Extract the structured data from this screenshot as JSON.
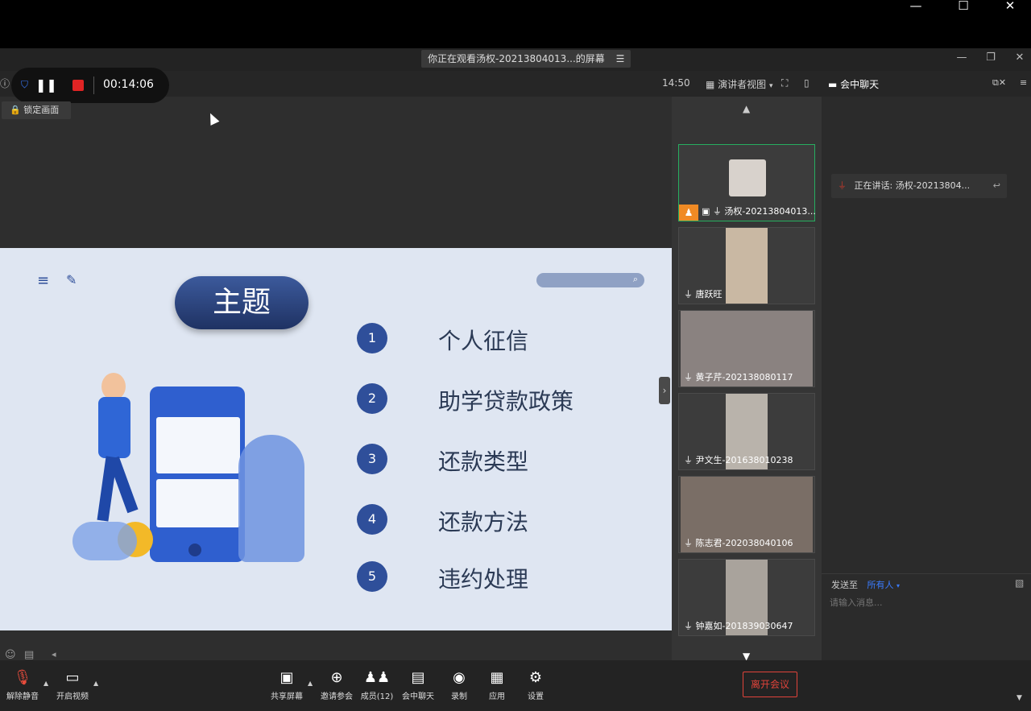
{
  "window": {
    "title": "你正在观看汤权-20213804013...的屏幕",
    "clock": "14:50",
    "presenter_view": "演讲者视图",
    "chat_toggle": "会中聊天"
  },
  "recording": {
    "timer": "00:14:06"
  },
  "lock_screen": "锁定画面",
  "slide": {
    "title": "主题",
    "topics": [
      {
        "num": "1",
        "text": "个人征信"
      },
      {
        "num": "2",
        "text": "助学贷款政策"
      },
      {
        "num": "3",
        "text": "还款类型"
      },
      {
        "num": "4",
        "text": "还款方法"
      },
      {
        "num": "5",
        "text": "违约处理"
      }
    ]
  },
  "participants": [
    {
      "name": "汤权-20213804013..."
    },
    {
      "name": "唐跃旺"
    },
    {
      "name": "黄子芹-202138080117"
    },
    {
      "name": "尹文生-201638010238"
    },
    {
      "name": "陈志君-202038040106"
    },
    {
      "name": "钟嘉如-201839030647"
    }
  ],
  "chat": {
    "speaking": "正在讲话: 汤权-20213804...",
    "send_to_label": "发送至",
    "send_to_value": "所有人",
    "input_placeholder": "请输入消息..."
  },
  "toolbar": {
    "unmute": "解除静音",
    "start_video": "开启视频",
    "share_screen": "共享屏幕",
    "invite": "邀请参会",
    "members": "成员(12)",
    "chat": "会中聊天",
    "record": "录制",
    "apps": "应用",
    "settings": "设置",
    "leave": "离开会议"
  },
  "colors": {
    "accent": "#2f4f9a",
    "leave": "#e0433a",
    "record": "#e02424"
  }
}
